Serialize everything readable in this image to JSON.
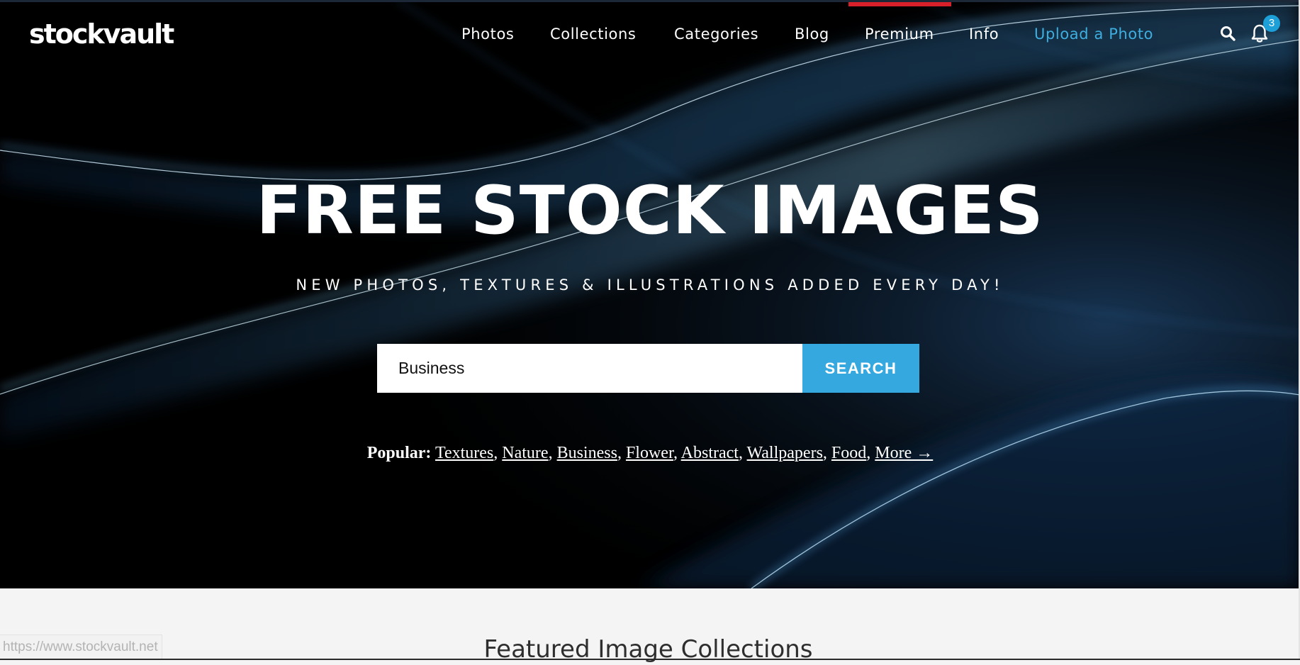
{
  "site": {
    "logo_text": "stockvault"
  },
  "nav": {
    "items": [
      {
        "label": "Photos"
      },
      {
        "label": "Collections"
      },
      {
        "label": "Categories"
      },
      {
        "label": "Blog"
      },
      {
        "label": "Premium"
      },
      {
        "label": "Info"
      },
      {
        "label": "Upload a Photo"
      }
    ],
    "search_icon": "search-icon",
    "bell_icon": "bell-icon",
    "notification_count": "3",
    "active_item": "Premium"
  },
  "hero": {
    "title": "FREE STOCK IMAGES",
    "subtitle": "NEW PHOTOS, TEXTURES & ILLUSTRATIONS ADDED EVERY DAY!"
  },
  "search": {
    "value": "Business",
    "button_label": "SEARCH"
  },
  "popular": {
    "label": "Popular:",
    "links": [
      "Textures",
      "Nature",
      "Business",
      "Flower",
      "Abstract",
      "Wallpapers",
      "Food",
      "More →"
    ]
  },
  "featured": {
    "title": "Featured Image Collections"
  },
  "status_bar": {
    "url": "https://www.stockvault.net"
  },
  "colors": {
    "accent": "#36a8e0",
    "premium_indicator": "#d8202a",
    "hero_background": "#000000",
    "page_background": "#f4f4f4"
  }
}
